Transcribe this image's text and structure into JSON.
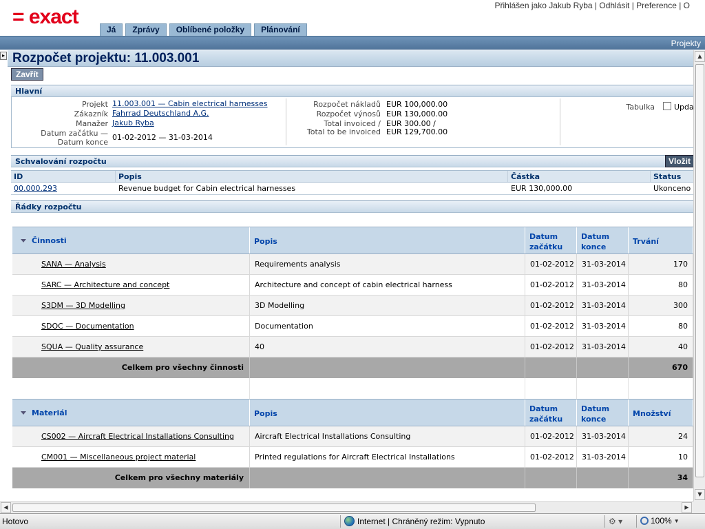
{
  "header": {
    "logo_text": "= exact",
    "user_links": "Přihlášen jako Jakub Ryba | Odhlásit | Preference | O",
    "nav": [
      "Já",
      "Zprávy",
      "Oblíbené položky",
      "Plánování"
    ],
    "module": "Projekty"
  },
  "page": {
    "title": "Rozpočet projektu: 11.003.001",
    "close_label": "Zavřít",
    "collapse_icon": "▸"
  },
  "main": {
    "section_title": "Hlavní",
    "project_label": "Projekt",
    "project_value": "11.003.001 — Cabin electrical harnesses",
    "customer_label": "Zákazník",
    "customer_value": "Fahrrad Deutschland A.G.",
    "manager_label": "Manažer",
    "manager_value": "Jakub Ryba",
    "dates_label_1": "Datum začátku —",
    "dates_label_2": "Datum konce",
    "dates_value": "01-02-2012 — 31-03-2014",
    "cost_budget_label": "Rozpočet nákladů",
    "cost_budget_value": "EUR 100,000.00",
    "revenue_budget_label": "Rozpočet výnosů",
    "revenue_budget_value": "EUR 130,000.00",
    "invoiced_label": "Total invoiced /",
    "invoiced_value": "EUR 300.00 /",
    "to_invoice_label": "Total to be invoiced",
    "to_invoice_value": "EUR 129,700.00",
    "table_label": "Tabulka",
    "update_label": "Upda"
  },
  "approval": {
    "section_title": "Schvalování rozpočtu",
    "insert_label": "Vložit",
    "columns": [
      "ID",
      "Popis",
      "Částka",
      "Status"
    ],
    "rows": [
      {
        "id": "00.000.293",
        "desc": "Revenue budget for Cabin electrical harnesses",
        "amount": "EUR 130,000.00",
        "status": "Ukonceno"
      }
    ]
  },
  "lines": {
    "section_title": "Řádky rozpočtu",
    "activities": {
      "columns": [
        "Činnosti",
        "Popis",
        "Datum začátku",
        "Datum konce",
        "Trvání"
      ],
      "rows": [
        {
          "name": "SANA — Analysis",
          "desc": "Requirements analysis",
          "start": "01-02-2012",
          "end": "31-03-2014",
          "value": "170"
        },
        {
          "name": "SARC — Architecture and concept",
          "desc": "Architecture and concept of cabin electrical harness",
          "start": "01-02-2012",
          "end": "31-03-2014",
          "value": "80"
        },
        {
          "name": "S3DM — 3D Modelling",
          "desc": "3D Modelling",
          "start": "01-02-2012",
          "end": "31-03-2014",
          "value": "300"
        },
        {
          "name": "SDOC — Documentation",
          "desc": "Documentation",
          "start": "01-02-2012",
          "end": "31-03-2014",
          "value": "80"
        },
        {
          "name": "SQUA — Quality assurance",
          "desc": "40",
          "start": "01-02-2012",
          "end": "31-03-2014",
          "value": "40"
        }
      ],
      "total_label": "Celkem pro všechny činnosti",
      "total_value": "670"
    },
    "materials": {
      "columns": [
        "Materiál",
        "Popis",
        "Datum začátku",
        "Datum konce",
        "Množství"
      ],
      "rows": [
        {
          "name": "CS002 — Aircraft Electrical Installations Consulting",
          "desc": "Aircraft Electrical Installations Consulting",
          "start": "01-02-2012",
          "end": "31-03-2014",
          "value": "24"
        },
        {
          "name": "CM001 — Miscellaneous project material",
          "desc": "Printed regulations for Aircraft Electrical Installations",
          "start": "01-02-2012",
          "end": "31-03-2014",
          "value": "10"
        }
      ],
      "total_label": "Celkem pro všechny materiály",
      "total_value": "34"
    }
  },
  "statusbar": {
    "status": "Hotovo",
    "zone": "Internet | Chráněný režim: Vypnuto",
    "zoom": "100%"
  }
}
